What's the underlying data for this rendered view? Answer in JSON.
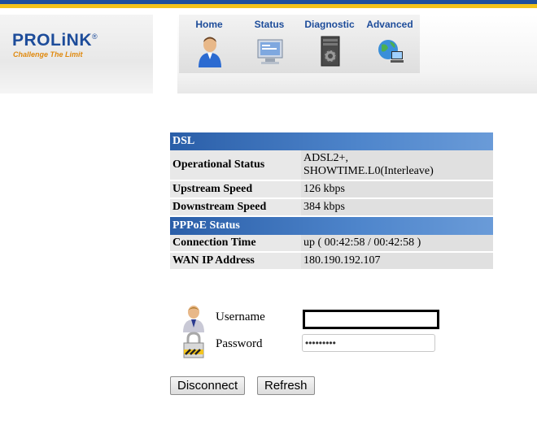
{
  "brand": {
    "name": "PROLiNK",
    "reg": "®",
    "tagline": "Challenge The Limit"
  },
  "nav": {
    "tabs": [
      {
        "label": "Home",
        "icon": "user-icon"
      },
      {
        "label": "Status",
        "icon": "monitor-icon"
      },
      {
        "label": "Diagnostic",
        "icon": "gear-server-icon"
      },
      {
        "label": "Advanced",
        "icon": "globe-pc-icon"
      }
    ]
  },
  "dsl": {
    "title": "DSL",
    "rows": [
      {
        "label": "Operational Status",
        "value_line1": "ADSL2+,",
        "value_line2": "SHOWTIME.L0(Interleave)"
      },
      {
        "label": "Upstream Speed",
        "value": "126 kbps"
      },
      {
        "label": "Downstream Speed",
        "value": "384 kbps"
      }
    ]
  },
  "pppoe": {
    "title": "PPPoE Status",
    "rows": [
      {
        "label": "Connection Time",
        "value": "up   ( 00:42:58 / 00:42:58 )"
      },
      {
        "label": "WAN IP Address",
        "value": "180.190.192.107"
      }
    ]
  },
  "login": {
    "username_label": "Username",
    "username_value": "",
    "password_label": "Password",
    "password_value": "•••••••••"
  },
  "buttons": {
    "disconnect": "Disconnect",
    "refresh": "Refresh"
  },
  "colors": {
    "brand_blue": "#1d4c9a",
    "brand_gold": "#f2c21a",
    "section_blue": "#2a5ea8"
  }
}
